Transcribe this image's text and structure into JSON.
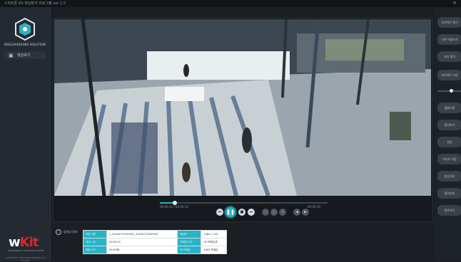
{
  "window": {
    "title": "스마트폰 Kit 영상분석 프로그램 ver 1.0",
    "close_label": "×"
  },
  "sidebar": {
    "logo_text": "KEEGUARDIANS SOLUTION",
    "menu": [
      {
        "icon": "film-icon",
        "label": "영상보기"
      }
    ],
    "brand": {
      "prefix": "w",
      "suffix": "Kit"
    },
    "brand_sub": "WEARABLE KIT ANALYSIS SYSTEM",
    "copyright": "COPYRIGHT 2019 KEEGUARDIANS ALL RIGHTS"
  },
  "player": {
    "time_current": "00:00:12 / 00:00:33",
    "time_end": "00:00:33",
    "progress": 0.09,
    "controls": [
      {
        "name": "skip-back-button",
        "label": "⏮"
      },
      {
        "name": "pause-button",
        "label": "❚❚"
      },
      {
        "name": "stop-button",
        "label": "■"
      },
      {
        "name": "skip-forward-button",
        "label": "⏭"
      },
      {
        "name": "zoom-out-button",
        "label": "−"
      },
      {
        "name": "zoom-reset-button",
        "label": "○"
      },
      {
        "name": "zoom-in-button",
        "label": "+"
      },
      {
        "name": "volume-down-button",
        "label": "◀"
      },
      {
        "name": "volume-up-button",
        "label": "▶"
      }
    ]
  },
  "rightbar": {
    "buttons": [
      "프로젝트 열기",
      "다른 이름으로",
      "파일 열기",
      "프로젝트 저장",
      "볼륨조절",
      "캡처하기",
      "설정",
      "이미지 저장",
      "영상저장",
      "출력정보",
      "종료하기"
    ],
    "volume": 0.55
  },
  "info": {
    "title": "동영상 정보",
    "rows": [
      [
        {
          "k": "파일 이름",
          "v": "C_20190715150922_20190715150944"
        },
        {
          "k": "해상도",
          "v": "1280 x 720"
        }
      ],
      [
        {
          "k": "재생 시간",
          "v": "00:00:33"
        },
        {
          "k": "프레임 속도",
          "v": "30 프레임/초"
        }
      ],
      [
        {
          "k": "파일 크기",
          "v": "30.6 MB"
        },
        {
          "k": "총 프레임",
          "v": "1002 프레임"
        }
      ]
    ]
  }
}
